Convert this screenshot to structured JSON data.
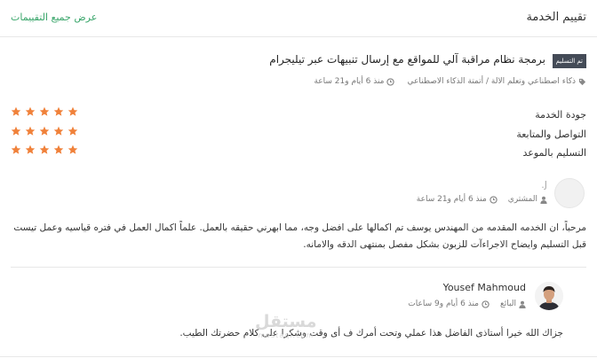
{
  "header": {
    "title": "تقييم الخدمة",
    "view_all": "عرض جميع التقييمات"
  },
  "service": {
    "badge": "تم التسليم",
    "title": "برمجة نظام مراقبة آلي للمواقع مع إرسال تنبيهات عبر تيليجرام",
    "category": "ذكاء اصطناعي وتعلم الالة / أتمتة الذكاء الاصطناعي",
    "time": "منذ 6 أيام و21 ساعة"
  },
  "ratings": [
    {
      "label": "جودة الخدمة",
      "stars": 5
    },
    {
      "label": "التواصل والمتابعة",
      "stars": 5
    },
    {
      "label": "التسليم بالموعد",
      "stars": 5
    }
  ],
  "buyer_review": {
    "name": "J.",
    "role": "المشتري",
    "time": "منذ 6 أيام و21 ساعة",
    "text": "مرحباً، ان الخدمه المقدمه من المهندس يوسف تم اكمالها على افضل وجه، مما ابهرني حقيقه بالعمل. علماً اكمال العمل في فتره قياسيه وعمل تيست قبل التسليم وايضاح الاجراءآت للزبون بشكل مفصل بمنتهى الدقه والامانه."
  },
  "seller_reply": {
    "name": "Yousef Mahmoud",
    "role": "البائع",
    "time": "منذ 6 أيام و9 ساعات",
    "text": "جزاك الله خيرا أستاذى الفاضل هذا عملي وتحت أمرك ف أى وقت وشكرا على كلام حضرتك الطيب."
  },
  "watermark": {
    "arabic": "مستقل",
    "latin": "mostaql.com"
  },
  "colors": {
    "star": "#f0813a",
    "link": "#3aa66b",
    "badge_bg": "#444b57"
  }
}
